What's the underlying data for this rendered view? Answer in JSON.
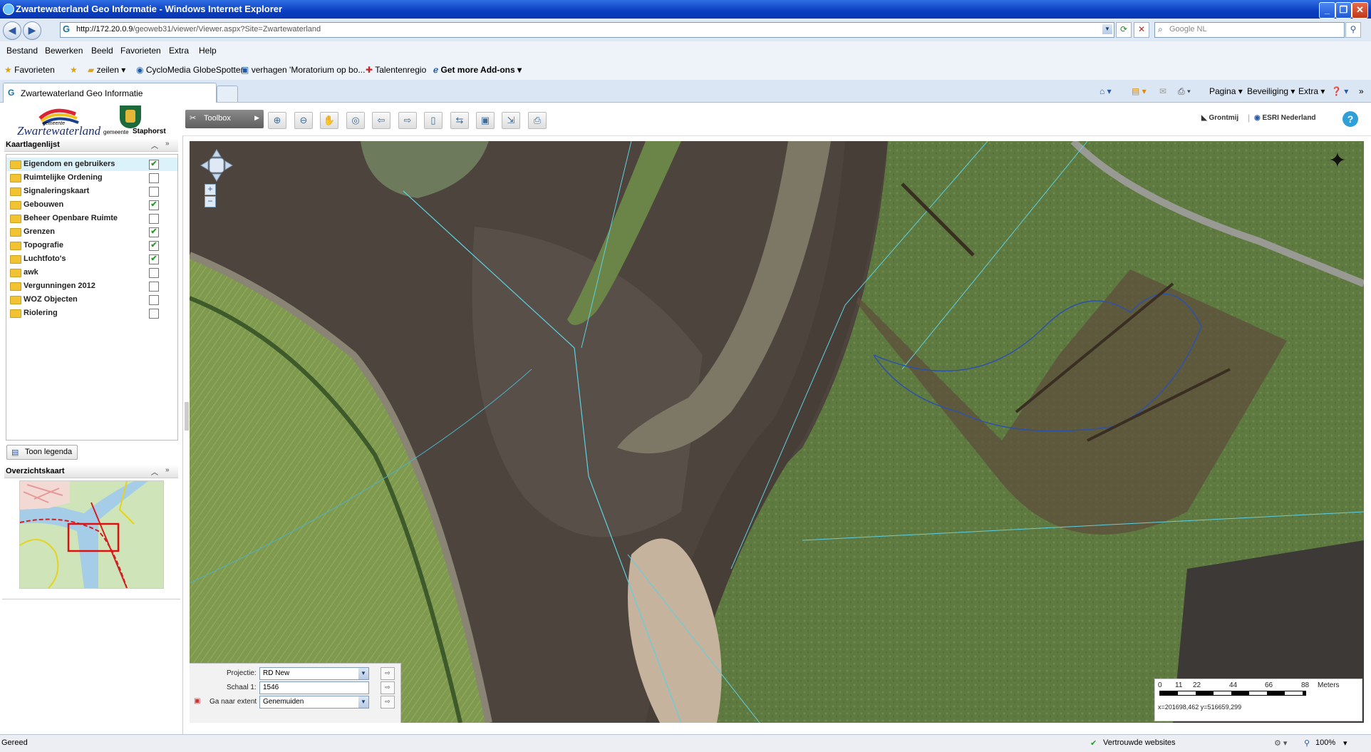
{
  "window": {
    "title": "Zwartewaterland Geo Informatie - Windows Internet Explorer",
    "controls": [
      "_",
      "❐",
      "✕"
    ]
  },
  "address": {
    "url_host": "http://172.20.0.9",
    "url_path": "/geoweb31/viewer/Viewer.aspx?Site=Zwartewaterland",
    "search_placeholder": "Google NL"
  },
  "menu": [
    "Bestand",
    "Bewerken",
    "Beeld",
    "Favorieten",
    "Extra",
    "Help"
  ],
  "favbar": {
    "favorites": "Favorieten",
    "items": [
      "zeilen",
      "CycloMedia GlobeSpotter",
      "verhagen 'Moratorium op bo...",
      "Talentenregio",
      "Get more Add-ons"
    ]
  },
  "tab": {
    "title": "Zwartewaterland Geo Informatie"
  },
  "commandbar": [
    "Pagina",
    "Beveiliging",
    "Extra"
  ],
  "logos": {
    "gemeente_small": "gemeente",
    "zwartewaterland": "Zwartewaterland",
    "gemeente_small2": "gemeente",
    "staphorst": "Staphorst"
  },
  "layers_panel": {
    "title": "Kaartlagenlijst",
    "items": [
      {
        "name": "Eigendom en gebruikers",
        "checked": true,
        "selected": true
      },
      {
        "name": "Ruimtelijke Ordening",
        "checked": false
      },
      {
        "name": "Signaleringskaart",
        "checked": false
      },
      {
        "name": "Gebouwen",
        "checked": true
      },
      {
        "name": "Beheer Openbare Ruimte",
        "checked": false
      },
      {
        "name": "Grenzen",
        "checked": true
      },
      {
        "name": "Topografie",
        "checked": true
      },
      {
        "name": "Luchtfoto's",
        "checked": true
      },
      {
        "name": "awk",
        "checked": false
      },
      {
        "name": "Vergunningen 2012",
        "checked": false
      },
      {
        "name": "WOZ Objecten",
        "checked": false
      },
      {
        "name": "Riolering",
        "checked": false
      }
    ],
    "legend_button": "Toon legenda"
  },
  "overview": {
    "title": "Overzichtskaart"
  },
  "toolbar": {
    "toolbox_label": "Toolbox",
    "brand1": "Grontmij",
    "brand2": "ESRI Nederland",
    "help": "?"
  },
  "map_controls": {
    "projection_label": "Projectie:",
    "projection_value": "RD New",
    "scale_label": "Schaal 1:",
    "scale_value": "1546",
    "extent_label": "Ga naar extent",
    "extent_value": "Genemuiden"
  },
  "scalebar": {
    "ticks": [
      "0",
      "11",
      "22",
      "44",
      "66",
      "88"
    ],
    "unit": "Meters",
    "coords": "x=201698,462 y=516659,299"
  },
  "status": {
    "left": "Gereed",
    "zone": "Vertrouwde websites",
    "zoom": "100%"
  }
}
